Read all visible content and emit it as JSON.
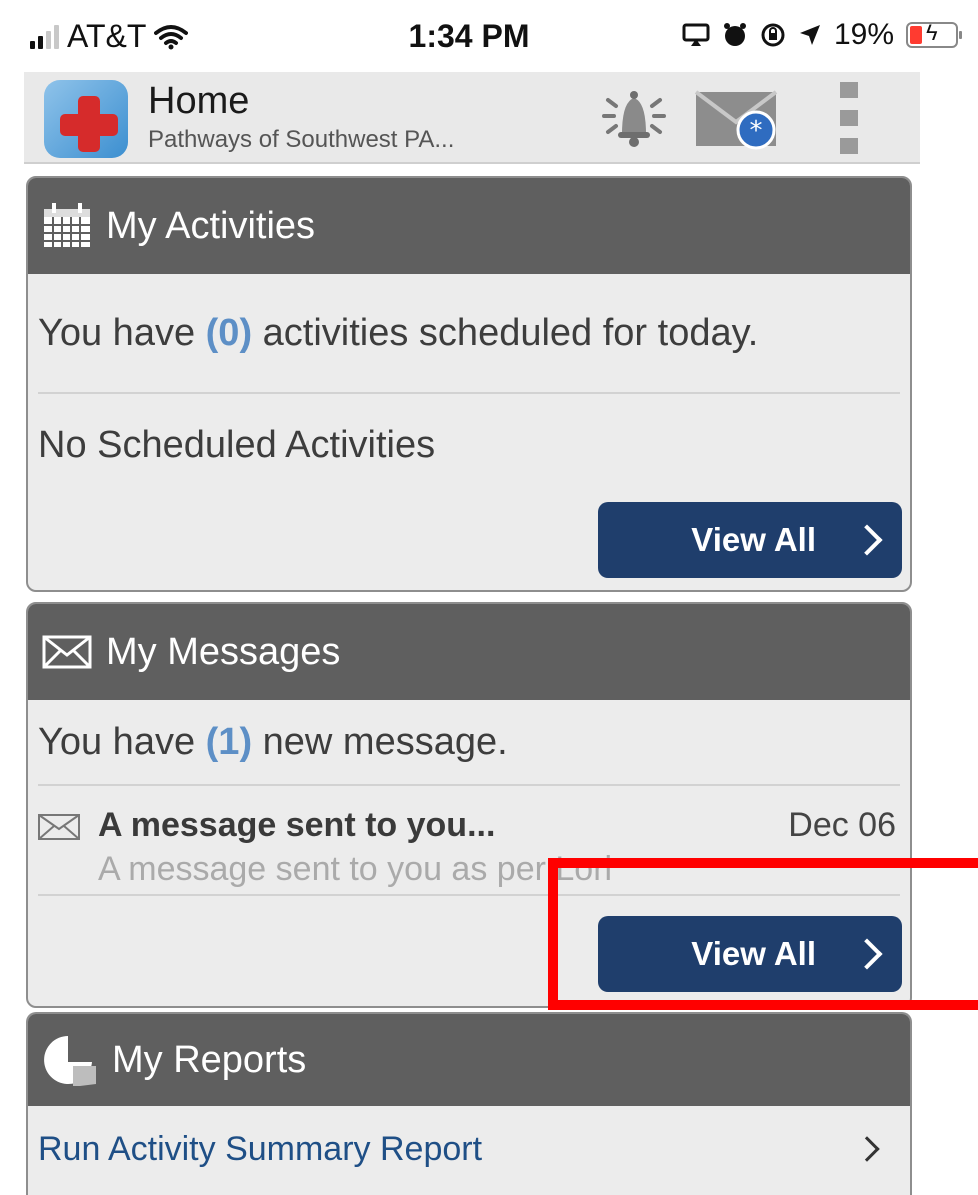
{
  "status_bar": {
    "carrier": "AT&T",
    "time": "1:34 PM",
    "battery_percent": "19%",
    "icons": [
      "signal-icon",
      "wifi-icon",
      "screen-mirror-icon",
      "alarm-icon",
      "rotation-lock-icon",
      "location-icon",
      "battery-icon"
    ]
  },
  "header": {
    "title": "Home",
    "subtitle": "Pathways of Southwest PA...",
    "icons": [
      "app-logo",
      "bell-icon",
      "mail-icon",
      "more-icon"
    ]
  },
  "activities": {
    "title": "My Activities",
    "summary_prefix": "You have ",
    "summary_count": "(0)",
    "summary_suffix": " activities scheduled for today.",
    "empty_text": "No Scheduled Activities",
    "view_all_label": "View All"
  },
  "messages": {
    "title": "My Messages",
    "summary_prefix": "You have ",
    "summary_count": "(1)",
    "summary_suffix": " new message.",
    "items": [
      {
        "title": "A message sent to you...",
        "date": "Dec 06",
        "preview": "A message sent to you as per Lori"
      }
    ],
    "view_all_label": "View All"
  },
  "reports": {
    "title": "My Reports",
    "items": [
      {
        "label": "Run Activity Summary Report"
      }
    ]
  },
  "colors": {
    "header_bar": "#5f5f5f",
    "button": "#1f3e6c",
    "count_accent": "#5d8fc6",
    "link": "#1f4f86",
    "highlight": "#ff0000"
  }
}
